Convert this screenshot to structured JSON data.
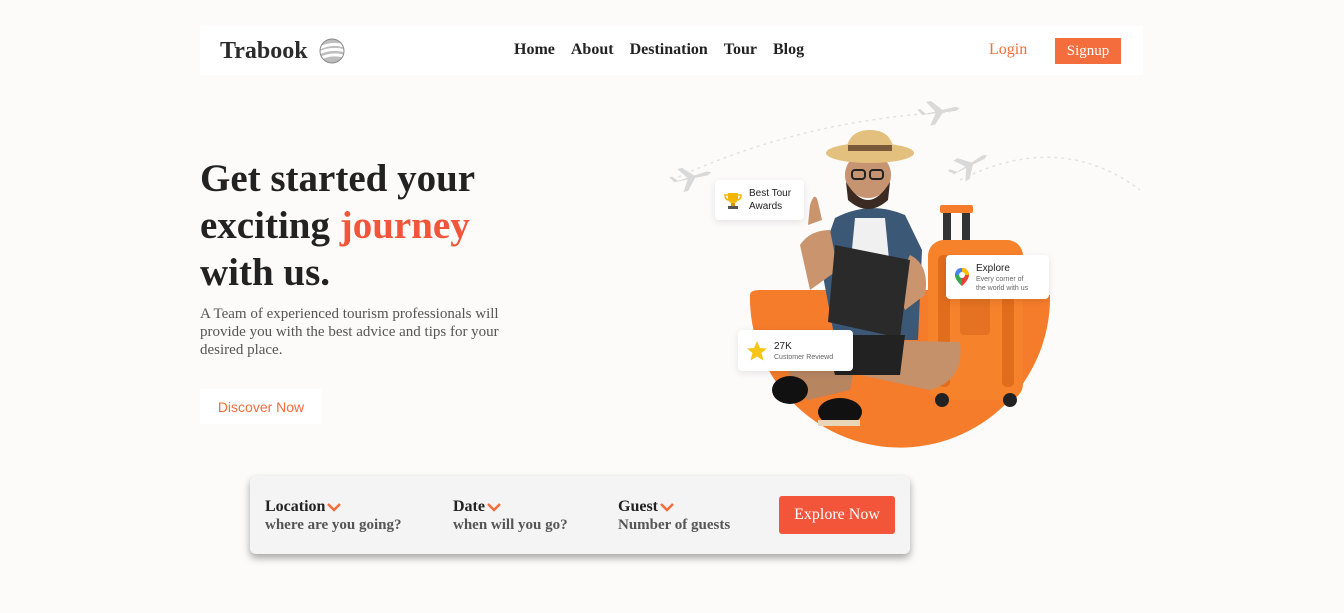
{
  "brand": {
    "name": "Trabook"
  },
  "nav": {
    "links": [
      "Home",
      "About",
      "Destination",
      "Tour",
      "Blog"
    ],
    "login": "Login",
    "signup": "Signup"
  },
  "hero": {
    "title_line1": "Get started your",
    "title_line2_prefix": "exciting ",
    "title_line2_accent": "journey",
    "title_line3": "with us.",
    "description": "A Team of experienced tourism professionals will provide you with the best advice and tips for your desired place.",
    "cta": "Discover Now"
  },
  "cards": {
    "award": {
      "line1": "Best Tour",
      "line2": "Awards"
    },
    "explore": {
      "title": "Explore",
      "sub1": "Every corner of",
      "sub2": "the world with us"
    },
    "reviews": {
      "title": "27K",
      "sub": "Customer Reviewd"
    }
  },
  "search": {
    "location_label": "Location",
    "location_placeholder": "where are you going?",
    "date_label": "Date",
    "date_placeholder": "when will you go?",
    "guest_label": "Guest",
    "guest_placeholder": "Number of guests",
    "button": "Explore Now"
  },
  "colors": {
    "accent": "#f3553a",
    "accent_light": "#f36d3d",
    "background": "#fcfbfa"
  }
}
